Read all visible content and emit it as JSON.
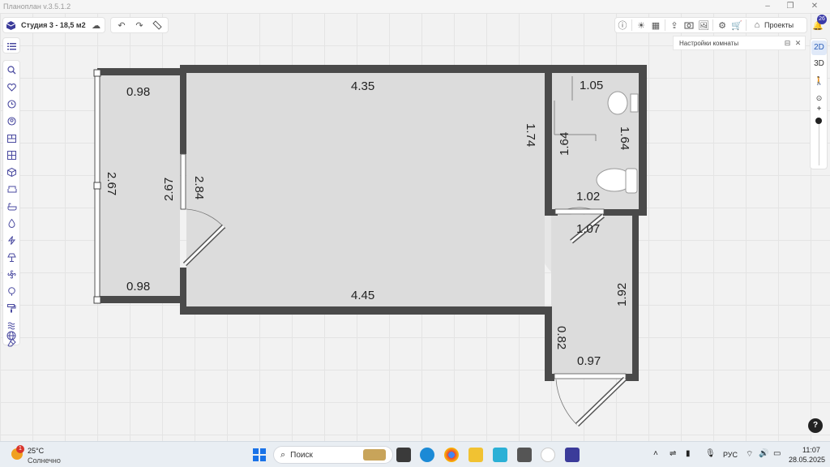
{
  "app": {
    "title": "Планоплан v.3.5.1.2"
  },
  "project": {
    "title": "Студия 3  - 18,5 м2"
  },
  "toolbar": {
    "projects_label": "Проекты",
    "notifications_count": "26"
  },
  "room_panel": {
    "title": "Настройки комнаты"
  },
  "view_modes": {
    "mode_2d": "2D",
    "mode_3d": "3D"
  },
  "plan": {
    "dimensions": [
      {
        "id": "dim-balcony-top",
        "text": "0.98"
      },
      {
        "id": "dim-balcony-bottom",
        "text": "0.98"
      },
      {
        "id": "dim-balcony-outer",
        "text": "2.67"
      },
      {
        "id": "dim-balcony-inner",
        "text": "2.67"
      },
      {
        "id": "dim-room-left",
        "text": "2.84"
      },
      {
        "id": "dim-room-top",
        "text": "4.35"
      },
      {
        "id": "dim-room-bottom",
        "text": "4.45"
      },
      {
        "id": "dim-room-right",
        "text": "1.74"
      },
      {
        "id": "dim-bath-top",
        "text": "1.05"
      },
      {
        "id": "dim-bath-left",
        "text": "1.64"
      },
      {
        "id": "dim-bath-right",
        "text": "1.64"
      },
      {
        "id": "dim-bath-bottom",
        "text": "1.02"
      },
      {
        "id": "dim-hall-top",
        "text": "1.07"
      },
      {
        "id": "dim-hall-right",
        "text": "1.92"
      },
      {
        "id": "dim-hall-left",
        "text": "0.82"
      },
      {
        "id": "dim-hall-bottom",
        "text": "0.97"
      }
    ]
  },
  "help": {
    "label": "?"
  },
  "taskbar": {
    "weather": {
      "temp": "25°C",
      "condition": "Солнечно",
      "alert": "1"
    },
    "search_label": "Поиск",
    "tray": {
      "lang": "РУС",
      "time": "11:07",
      "date": "28.05.2025"
    }
  }
}
